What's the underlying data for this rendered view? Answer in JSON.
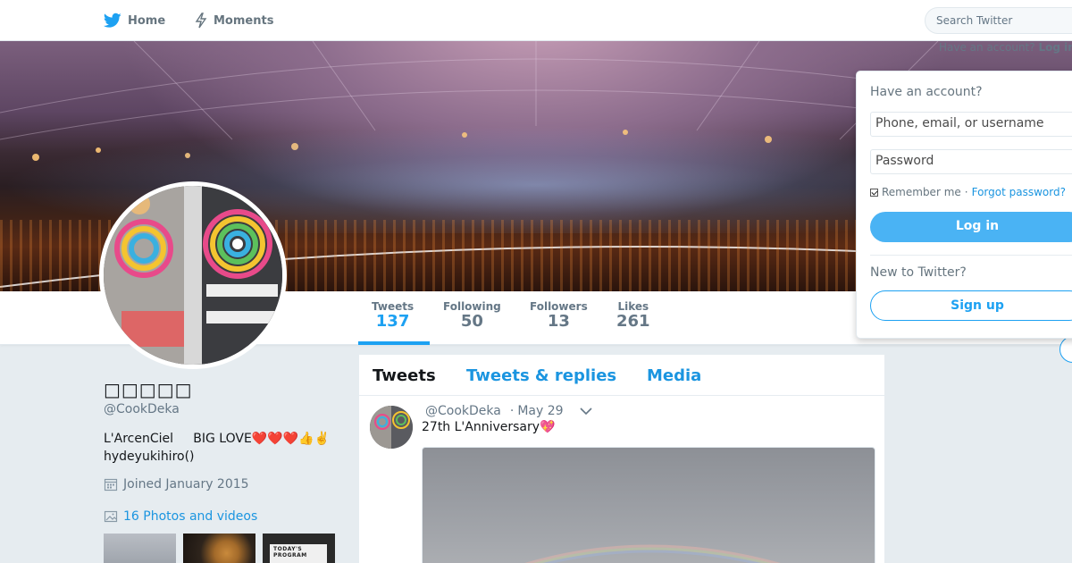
{
  "nav": {
    "home_label": "Home",
    "moments_label": "Moments",
    "search_placeholder": "Search Twitter",
    "have_account_text": "Have an account?",
    "login_link": "Log in"
  },
  "profile": {
    "name": "□□□□□",
    "handle": "@CookDeka",
    "bio": "L'ArcenCiel     BIG LOVE❤️❤️❤️👍✌️\nhydeyukihiro()",
    "joined": "Joined January 2015",
    "photos_link": "16 Photos and videos",
    "thumb3_text": "TODAY'S PROGRAM"
  },
  "stats": [
    {
      "label": "Tweets",
      "value": "137"
    },
    {
      "label": "Following",
      "value": "50"
    },
    {
      "label": "Followers",
      "value": "13"
    },
    {
      "label": "Likes",
      "value": "261"
    }
  ],
  "timeline": {
    "tabs": [
      "Tweets",
      "Tweets & replies",
      "Media"
    ],
    "tweet": {
      "handle": "@CookDeka",
      "date": "May 29",
      "text": "27th L'Anniversary💖"
    }
  },
  "login": {
    "title": "Have an account?",
    "username_placeholder": "Phone, email, or username",
    "password_placeholder": "Password",
    "remember": "Remember me",
    "separator": "·",
    "forgot": "Forgot password?",
    "login_button": "Log in",
    "new_text": "New to Twitter?",
    "signup_button": "Sign up"
  },
  "colors": {
    "accent": "#1da1f2",
    "link": "#1b95e0",
    "login_button": "#4ab3f4"
  }
}
